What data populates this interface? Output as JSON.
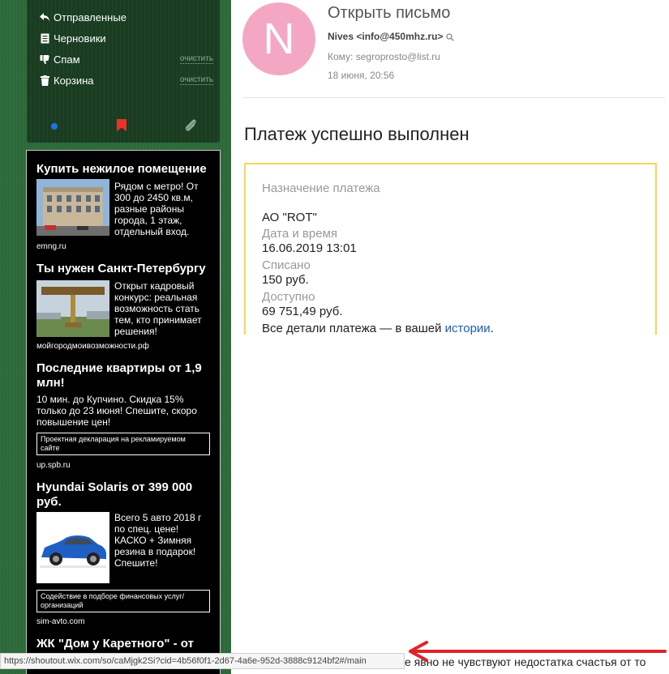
{
  "folders": [
    {
      "name": "Отправленные",
      "icon": "reply-arrow-icon"
    },
    {
      "name": "Черновики",
      "icon": "draft-icon"
    },
    {
      "name": "Спам",
      "icon": "thumbs-down-icon",
      "action": "очистить"
    },
    {
      "name": "Корзина",
      "icon": "trash-icon",
      "action": "очистить"
    }
  ],
  "folder_tools": {
    "dot_color": "#1f73e8",
    "flag_color": "#e8332a",
    "clip_icon": "paperclip-icon"
  },
  "ads": [
    {
      "title": "Купить нежилое помещение",
      "text": "Рядом с метро! От 300 до 2450 кв.м, разные районы города, 1 этаж, отдельный вход.",
      "domain": "emng.ru"
    },
    {
      "title": "Ты нужен Санкт-Петербургу",
      "text": "Открыт кадровый конкурс: реальная возможность стать тем, кто принимает решения!",
      "domain": "мойгородмоивозможности.рф"
    },
    {
      "title": "Последние квартиры от 1,9 млн!",
      "text": "10 мин. до Купчино. Скидка 15% только до 23 июня! Спешите, скоро повышение цен!",
      "disclaimer": "Проектная декларация на рекламируемом сайте",
      "domain": "up.spb.ru"
    },
    {
      "title": "Hyundai Solaris от 399 000 руб.",
      "text": "Всего 5 авто 2018 г по спец. цене! КАСКО + Зимняя резина в подарок! Спешите!",
      "disclaimer": "Содействие в подборе финансовых услуг/организаций",
      "domain": "sim-avto.com"
    },
    {
      "title": "ЖК \"Дом у Каретного\" - от"
    }
  ],
  "message": {
    "avatar_letter": "N",
    "avatar_color": "#f4a7c3",
    "window_title": "Открыть письмо",
    "from": "Nives <info@450mhz.ru>",
    "to": "Кому: segroprosto@list.ru",
    "date": "18 июня, 20:56",
    "subject": "Платеж успешно выполнен"
  },
  "card": {
    "border_color": "#f6d65a",
    "purpose_label": "Назначение платежа",
    "purpose_value": "АО \"ROT\"",
    "datetime_label": "Дата и время",
    "datetime_value": "16.06.2019 13:01",
    "debited_label": "Списано",
    "debited_value": "150 руб.",
    "available_label": "Доступно",
    "available_value": "69 751,49 руб.",
    "details_text": "Все детали платежа — в вашей ",
    "details_link": "истории",
    "details_end": "."
  },
  "statusbar": {
    "url": "https://shoutout.wix.com/so/caMjgk2Si?cid=4b56f0f1-2d67-4a6e-952d-3888c9124bf2#/main",
    "peek_text": "е явно не чувствуют недостатка счастья от то",
    "arrow_color": "#e0242a"
  }
}
